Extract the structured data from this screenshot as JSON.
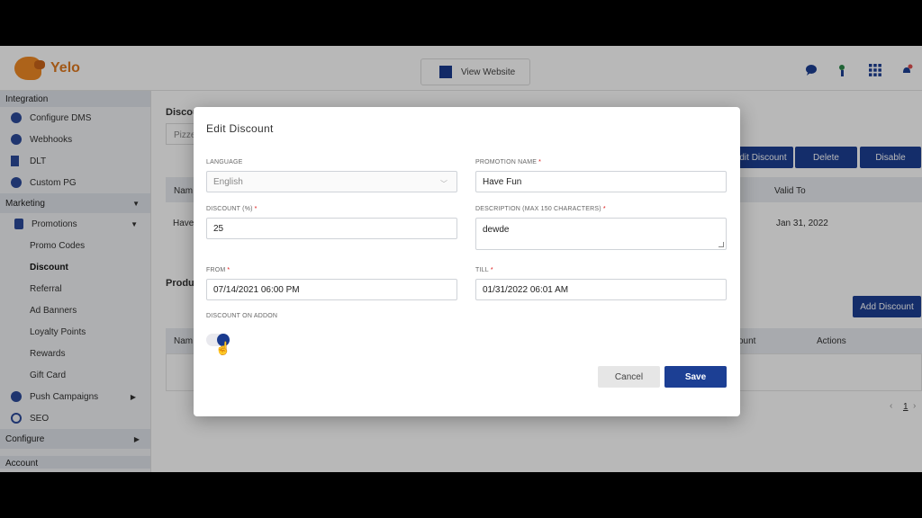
{
  "app": {
    "logo_text": "Yelo",
    "brand_color": "#1c3f94",
    "accent_color": "#e07b20"
  },
  "topbar": {
    "view_website": "View Website"
  },
  "sidebar": {
    "integration_header": "Integration",
    "integration_items": [
      "Configure DMS",
      "Webhooks",
      "DLT",
      "Custom PG"
    ],
    "marketing_header": "Marketing",
    "promotions_label": "Promotions",
    "promotion_items": [
      "Promo Codes",
      "Discount",
      "Referral",
      "Ad Banners",
      "Loyalty Points",
      "Rewards",
      "Gift Card"
    ],
    "push_campaigns": "Push Campaigns",
    "seo": "SEO",
    "configure_header": "Configure",
    "account_header": "Account"
  },
  "background": {
    "section_title": "Discou",
    "search_partial": "Pizze",
    "edit_discount_btn": "dit Discount",
    "delete_btn": "Delete",
    "disable_btn": "Disable",
    "col_name": "Nam",
    "col_valid_to": "Valid To",
    "row_name": "Have",
    "row_valid_to": "Jan 31, 2022",
    "products_title": "Produ",
    "add_discount_btn": "Add Discount",
    "col_name2": "Nam",
    "col_amount": "ount",
    "col_actions": "Actions",
    "page_number": "1"
  },
  "modal": {
    "title": "Edit Discount",
    "language_label": "LANGUAGE",
    "language_value": "English",
    "promotion_name_label": "PROMOTION NAME",
    "promotion_name_value": "Have Fun",
    "discount_label": "DISCOUNT (%)",
    "discount_value": "25",
    "description_label": "DESCRIPTION (MAX 150 CHARACTERS)",
    "description_value": "dewde",
    "from_label": "FROM",
    "from_value": "07/14/2021 06:00 PM",
    "till_label": "TILL",
    "till_value": "01/31/2022 06:01 AM",
    "addon_label": "DISCOUNT ON ADDON",
    "addon_enabled": true,
    "cancel_label": "Cancel",
    "save_label": "Save"
  }
}
